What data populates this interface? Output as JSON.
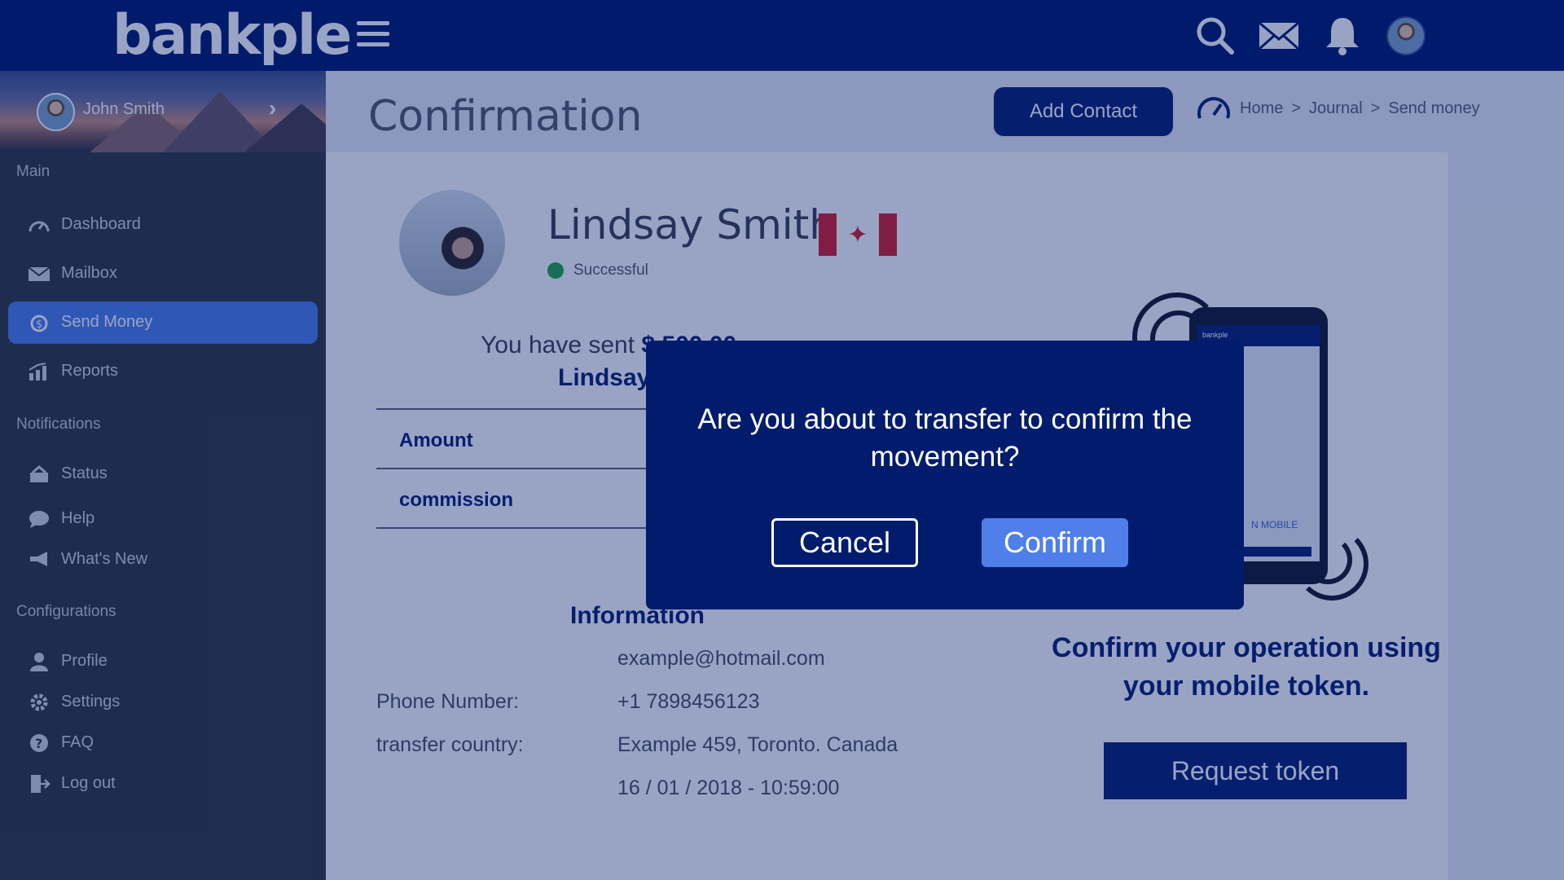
{
  "app": {
    "logo": "bankple"
  },
  "topbar": {
    "icons": [
      "search-icon",
      "mail-icon",
      "bell-icon"
    ]
  },
  "user": {
    "name": "John Smith"
  },
  "sidebar": {
    "sections": {
      "main": "Main",
      "notifications": "Notifications",
      "configurations": "Configurations"
    },
    "items": [
      {
        "label": "Dashboard",
        "icon": "speedometer-icon"
      },
      {
        "label": "Mailbox",
        "icon": "mail-icon"
      },
      {
        "label": "Send Money",
        "icon": "money-transfer-icon",
        "active": true
      },
      {
        "label": "Reports",
        "icon": "bar-chart-icon"
      },
      {
        "label": "Status",
        "icon": "status-icon"
      },
      {
        "label": "Help",
        "icon": "chat-bubble-icon"
      },
      {
        "label": "What's New",
        "icon": "megaphone-icon"
      },
      {
        "label": "Profile",
        "icon": "user-icon"
      },
      {
        "label": "Settings",
        "icon": "gear-icon"
      },
      {
        "label": "FAQ",
        "icon": "question-icon"
      },
      {
        "label": "Log out",
        "icon": "logout-icon"
      }
    ]
  },
  "page": {
    "title": "Confirmation",
    "add_contact": "Add Contact",
    "breadcrumb": [
      "Home",
      "Journal",
      "Send money"
    ]
  },
  "contact": {
    "name": "Lindsay Smith",
    "status": "Successful",
    "sent_prefix": "You have sent",
    "sent_amount": "$ 500.00",
    "sent_name": "Lindsay",
    "rows": [
      "Amount",
      "commission"
    ]
  },
  "information": {
    "title": "Information",
    "email": "example@hotmail.com",
    "phone_label": "Phone Number:",
    "phone": "+1 7898456123",
    "country_label": "transfer country:",
    "address": "Example 459, Toronto. Canada",
    "datetime": "16 / 01 / 2018 -  10:59:00"
  },
  "token": {
    "title": "Confirm your operation using your mobile token.",
    "button": "Request token",
    "phone_screen_text": "N MOBILE"
  },
  "modal": {
    "message": "Are you about to transfer to confirm the movement?",
    "cancel": "Cancel",
    "confirm": "Confirm"
  },
  "colors": {
    "navy": "#011c6c",
    "accent": "#4f7fe8",
    "success": "#25a648",
    "sidebar": "#33383f"
  }
}
